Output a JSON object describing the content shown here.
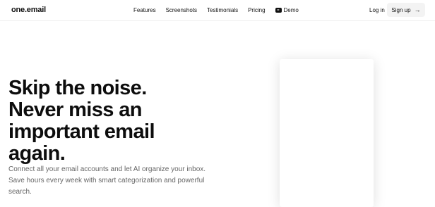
{
  "brand": {
    "name": "one.email"
  },
  "nav": {
    "links": [
      "Features",
      "Screenshots",
      "Testimonials",
      "Pricing"
    ],
    "demo_label": "Demo",
    "login_label": "Log in",
    "signup_label": "Sign up"
  },
  "hero": {
    "headline_lines": [
      "Skip the noise.",
      "Never miss an",
      "important email",
      "again."
    ],
    "subtext": "Connect all your email accounts and let AI organize your inbox. Save hours every week with smart categorization and powerful search."
  }
}
